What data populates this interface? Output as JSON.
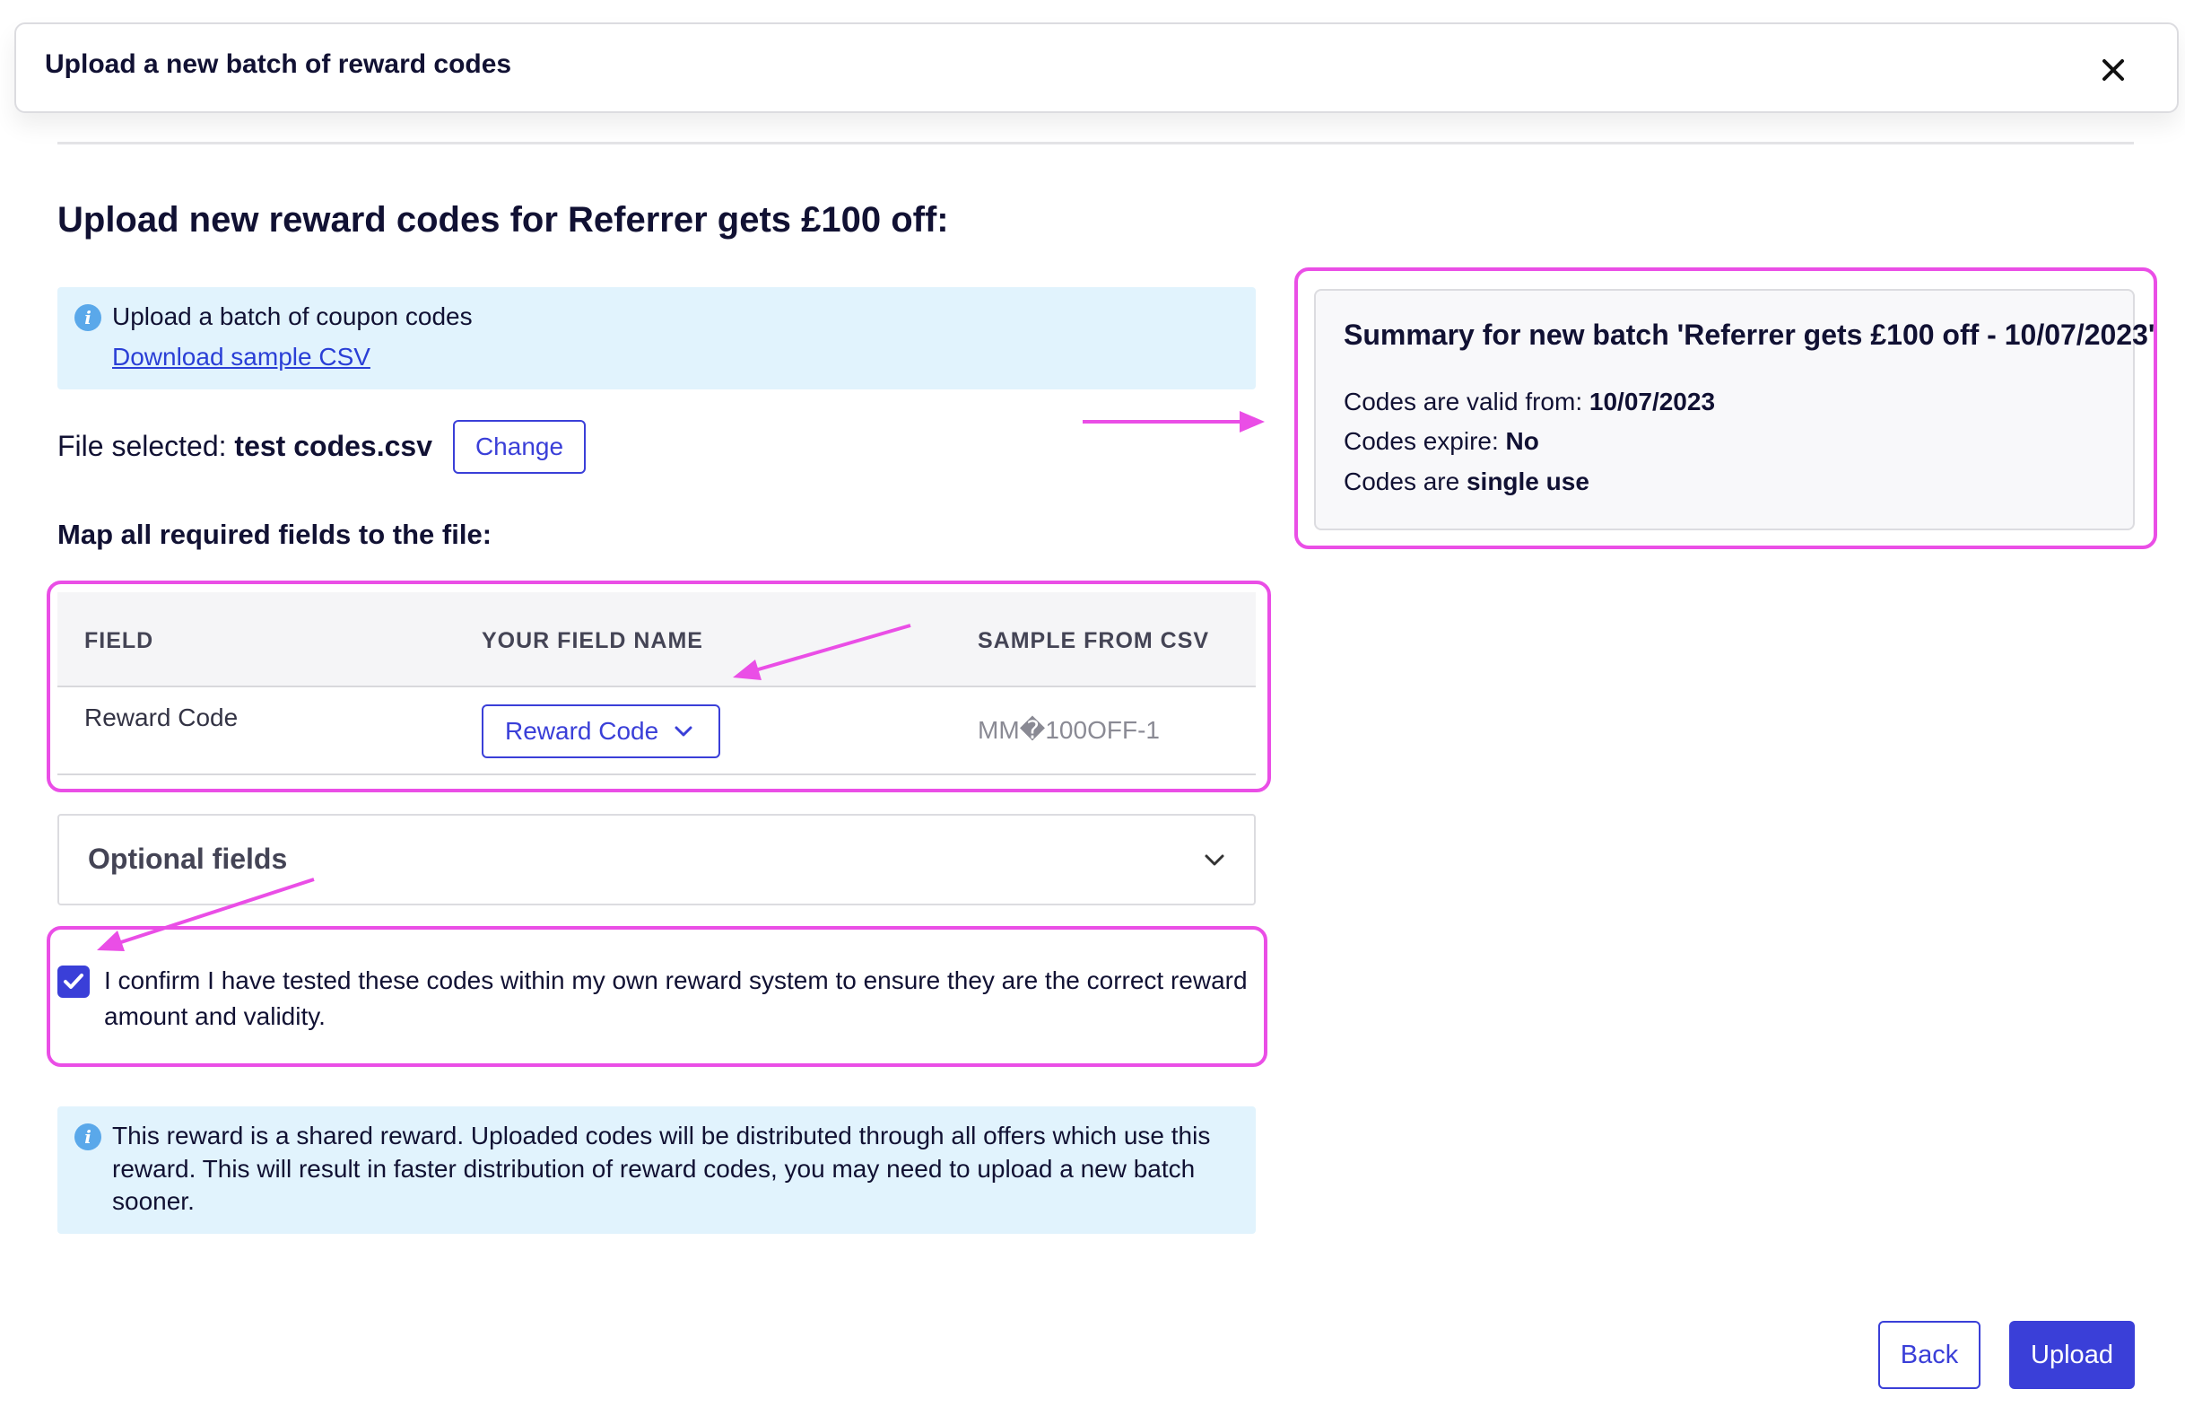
{
  "modal": {
    "title": "Upload a new batch of reward codes",
    "close_icon": "close-icon"
  },
  "page_title": "Upload new reward codes for Referrer gets £100 off:",
  "info_box": {
    "icon": "info-icon",
    "text": "Upload a batch of coupon codes",
    "link_label": "Download sample CSV"
  },
  "file": {
    "label": "File selected: ",
    "name": "test codes.csv",
    "change_label": "Change"
  },
  "map_title": "Map all required fields to the file:",
  "table": {
    "headers": [
      "FIELD",
      "YOUR FIELD NAME",
      "SAMPLE FROM CSV"
    ],
    "rows": [
      {
        "field": "Reward Code",
        "your_field_name": "Reward Code",
        "sample": "MM�100OFF-1"
      }
    ]
  },
  "optional_fields": {
    "label": "Optional fields",
    "expanded": false
  },
  "confirm": {
    "checked": true,
    "text": "I confirm I have tested these codes within my own reward system to ensure they are the correct reward amount and validity."
  },
  "shared_info": {
    "line1": "This reward is a shared reward. Uploaded codes will be distributed through all offers which use this",
    "line2": "reward. This will result in faster distribution of reward codes, you may need to upload a new batch",
    "line3": "sooner."
  },
  "summary": {
    "title": "Summary for new batch 'Referrer gets £100 off - 10/07/2023'",
    "valid_from_label": "Codes are valid from: ",
    "valid_from_value": "10/07/2023",
    "expire_label": "Codes expire: ",
    "expire_value": "No",
    "use_label": "Codes are ",
    "use_value": "single use"
  },
  "buttons": {
    "back": "Back",
    "upload": "Upload"
  },
  "colors": {
    "accent": "#3a3fd8",
    "annotation": "#ea4ee6",
    "info_bg": "#e1f3fd"
  }
}
